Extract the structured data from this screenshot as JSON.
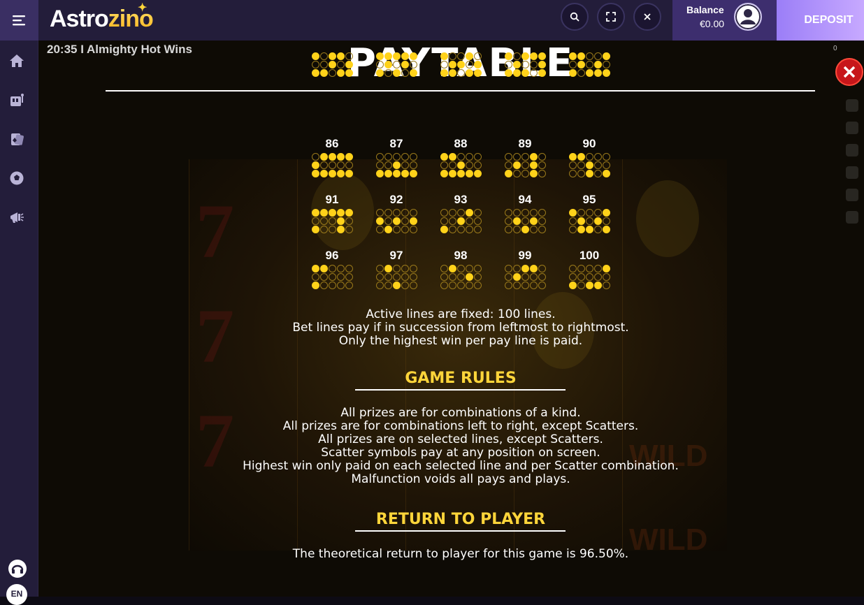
{
  "sidebar": {
    "menu_icon": "hamburger-icon",
    "items": [
      {
        "icon": "home-icon"
      },
      {
        "icon": "casino-icon"
      },
      {
        "icon": "live-casino-icon"
      },
      {
        "icon": "sports-icon"
      },
      {
        "icon": "promotions-icon"
      }
    ],
    "support_icon": "headset-icon",
    "language": "EN"
  },
  "header": {
    "logo_first": "Astro",
    "logo_second": "zino",
    "search_icon": "search-icon",
    "fullscreen_icon": "fullscreen-icon",
    "close_icon": "close-icon",
    "balance_label": "Balance",
    "balance_value": "€0.00",
    "deposit_label": "DEPOSIT",
    "colors": {
      "bg": "#231d3a",
      "deposit": "#b093fb",
      "accent": "#ffd53a"
    }
  },
  "game": {
    "status_text": "20:35 I Almighty Hot Wins",
    "corner_counter": "0",
    "paytable_title": "PAYTABLE",
    "close_icon": "close-x-icon",
    "paylines": [
      {
        "num": "",
        "pattern": [
          [
            0,
            1,
            2,
            2,
            1
          ],
          [
            1,
            1,
            0,
            1,
            0
          ],
          [
            2,
            2,
            1,
            0,
            2
          ]
        ]
      },
      {
        "num": "",
        "pattern": [
          [
            0,
            2,
            2,
            2,
            0
          ],
          [
            1,
            0,
            1,
            0,
            1
          ],
          [
            2,
            1,
            0,
            1,
            2
          ]
        ]
      },
      {
        "num": "",
        "pattern": [
          [
            0,
            1,
            1,
            2,
            1
          ],
          [
            1,
            0,
            0,
            1,
            2
          ],
          [
            2,
            0,
            1,
            0,
            2
          ]
        ]
      },
      {
        "num": "",
        "pattern": [
          [
            0,
            1,
            2,
            2,
            0
          ],
          [
            1,
            0,
            1,
            1,
            0
          ],
          [
            2,
            0,
            0,
            1,
            0
          ]
        ]
      },
      {
        "num": "",
        "pattern": [
          [
            0,
            0,
            1,
            1,
            0
          ],
          [
            1,
            2,
            1,
            0,
            1
          ],
          [
            2,
            1,
            2,
            0,
            0
          ]
        ]
      },
      {
        "num": "86",
        "pattern": [
          [
            1,
            0,
            0,
            2,
            2
          ],
          [
            0,
            1,
            1,
            1,
            1
          ],
          [
            2,
            2,
            2,
            2,
            2
          ]
        ]
      },
      {
        "num": "87",
        "pattern": [
          [
            1,
            1,
            1,
            1,
            1
          ],
          [
            1,
            1,
            2,
            1,
            1
          ],
          [
            2,
            2,
            2,
            2,
            2
          ]
        ]
      },
      {
        "num": "88",
        "pattern": [
          [
            0,
            0,
            1,
            1,
            1
          ],
          [
            1,
            1,
            0,
            1,
            1
          ],
          [
            2,
            2,
            2,
            2,
            0
          ]
        ]
      },
      {
        "num": "89",
        "pattern": [
          [
            1,
            1,
            1,
            0,
            1
          ],
          [
            1,
            0,
            1,
            0,
            1
          ],
          [
            0,
            1,
            1,
            2,
            1
          ]
        ]
      },
      {
        "num": "90",
        "pattern": [
          [
            0,
            0,
            1,
            1,
            1
          ],
          [
            1,
            1,
            0,
            1,
            1
          ],
          [
            1,
            1,
            2,
            1,
            2
          ]
        ]
      },
      {
        "num": "91",
        "pattern": [
          [
            2,
            2,
            2,
            0,
            2
          ],
          [
            1,
            1,
            1,
            2,
            1
          ],
          [
            2,
            1,
            1,
            2,
            1
          ]
        ]
      },
      {
        "num": "92",
        "pattern": [
          [
            1,
            1,
            1,
            1,
            1
          ],
          [
            2,
            1,
            0,
            1,
            2
          ],
          [
            1,
            0,
            1,
            1,
            1
          ]
        ]
      },
      {
        "num": "93",
        "pattern": [
          [
            1,
            1,
            1,
            2,
            1
          ],
          [
            1,
            1,
            2,
            1,
            1
          ],
          [
            2,
            1,
            1,
            1,
            1
          ]
        ]
      },
      {
        "num": "94",
        "pattern": [
          [
            1,
            1,
            1,
            1,
            1
          ],
          [
            1,
            2,
            1,
            2,
            1
          ],
          [
            1,
            1,
            2,
            1,
            1
          ]
        ]
      },
      {
        "num": "95",
        "pattern": [
          [
            2,
            1,
            1,
            1,
            2
          ],
          [
            1,
            2,
            1,
            2,
            1
          ],
          [
            1,
            2,
            2,
            1,
            2
          ]
        ]
      },
      {
        "num": "96",
        "pattern": [
          [
            0,
            2,
            1,
            1,
            1
          ],
          [
            1,
            1,
            1,
            1,
            1
          ],
          [
            2,
            1,
            1,
            1,
            1
          ]
        ]
      },
      {
        "num": "97",
        "pattern": [
          [
            1,
            2,
            1,
            1,
            1
          ],
          [
            1,
            1,
            1,
            1,
            1
          ],
          [
            1,
            1,
            2,
            1,
            1
          ]
        ]
      },
      {
        "num": "98",
        "pattern": [
          [
            1,
            2,
            1,
            1,
            1
          ],
          [
            1,
            1,
            1,
            2,
            1
          ],
          [
            1,
            1,
            1,
            1,
            1
          ]
        ]
      },
      {
        "num": "99",
        "pattern": [
          [
            1,
            1,
            2,
            2,
            1
          ],
          [
            1,
            2,
            1,
            1,
            1
          ],
          [
            1,
            1,
            1,
            1,
            1
          ]
        ]
      },
      {
        "num": "100",
        "pattern": [
          [
            1,
            1,
            1,
            1,
            2
          ],
          [
            1,
            1,
            1,
            1,
            1
          ],
          [
            2,
            1,
            2,
            2,
            1
          ]
        ]
      }
    ],
    "lines_info": [
      "Active lines are fixed: 100 lines.",
      "Bet lines pay if in succession from leftmost to rightmost.",
      "Only the highest win per pay line is paid."
    ],
    "rules_title": "GAME RULES",
    "rules": [
      "All prizes are for combinations of a kind.",
      "All prizes are for combinations left to right, except Scatters.",
      "All prizes are on selected lines, except Scatters.",
      "Scatter symbols pay at any position on screen.",
      "Highest win only paid on each selected line and per Scatter combination.",
      "Malfunction voids all pays and plays."
    ],
    "rtp_title": "RETURN TO PLAYER",
    "rtp_text": "The theoretical return to player for this game is 96.50%.",
    "background_symbols": [
      "7",
      "7",
      "7",
      "WILD",
      "WILD"
    ]
  }
}
